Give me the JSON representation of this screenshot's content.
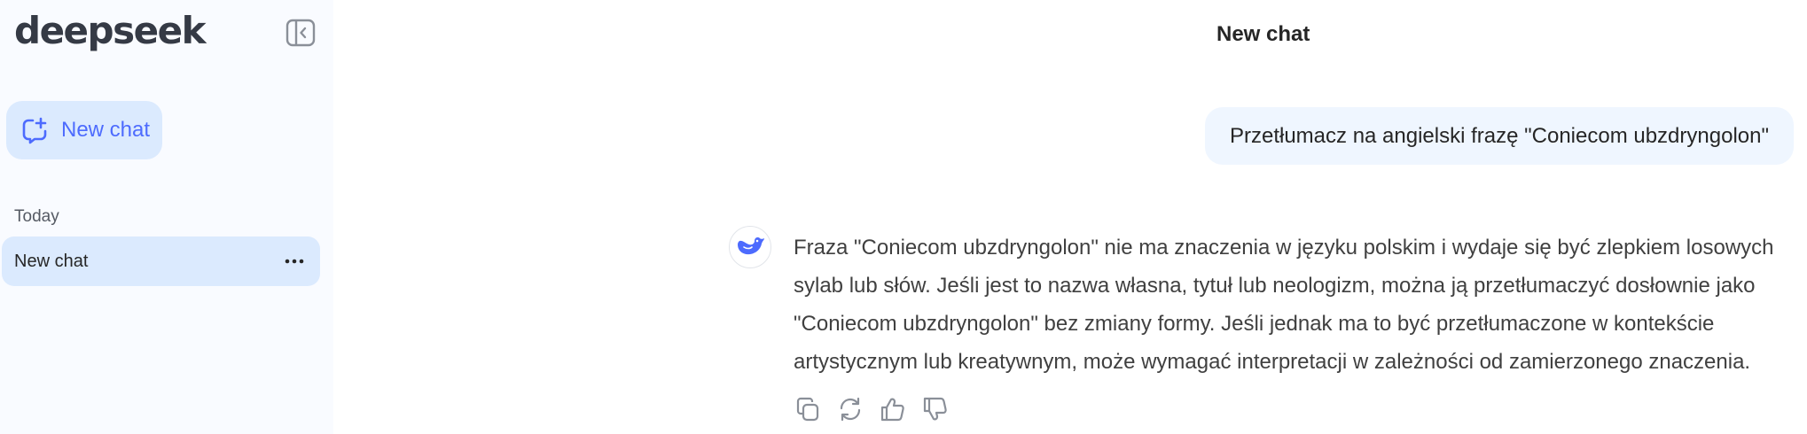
{
  "app": {
    "logo_text": "deepseek"
  },
  "sidebar": {
    "new_chat_label": "New chat",
    "section_today": "Today",
    "history": [
      {
        "title": "New chat"
      }
    ]
  },
  "header": {
    "title": "New chat"
  },
  "conversation": {
    "user_message": "Przetłumacz na angielski frazę \"Coniecom ubzdryngolon\"",
    "assistant_lines": [
      "Fraza \"Coniecom ubzdryngolon\" nie ma znaczenia w języku polskim i wydaje się być zlepkiem losowych",
      "sylab lub słów. Jeśli jest to nazwa własna, tytuł lub neologizm, można ją przetłumaczyć dosłownie jako",
      "\"Coniecom ubzdryngolon\" bez zmiany formy. Jeśli jednak ma to być przetłumaczone w kontekście",
      "artystycznym lub kreatywnym, może wymagać interpretacji w zależności od zamierzonego znaczenia."
    ]
  },
  "icons": {
    "collapse": "sidebar-collapse-icon",
    "new_chat": "new-chat-icon",
    "more": "more-icon",
    "avatar": "deepseek-whale-icon",
    "copy": "copy-icon",
    "regenerate": "regenerate-icon",
    "like": "thumbs-up-icon",
    "dislike": "thumbs-down-icon"
  },
  "colors": {
    "accent": "#4d6bfe",
    "sidebar_bg": "#f9fbff",
    "selected_bg": "#dbeafe",
    "user_bubble_bg": "#eff6ff"
  }
}
